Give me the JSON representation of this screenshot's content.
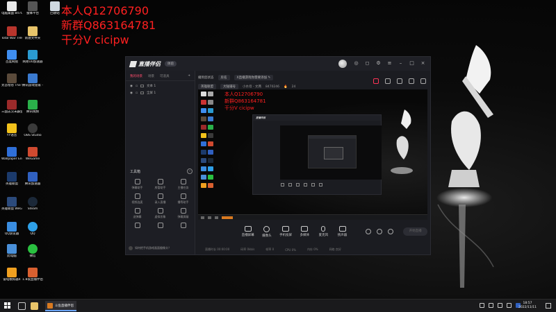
{
  "overlay": {
    "line1": "本人Q12706790",
    "line2": "新群Q863164781",
    "line3": "干分V cicipw"
  },
  "desktop_icons": [
    {
      "label": "电脑桌面\n8470246",
      "icon": "pc-folder-icon",
      "color": "#e8e8e8"
    },
    {
      "label": "Total War THREE KI...",
      "icon": "total-war-icon",
      "color": "#b8352c"
    },
    {
      "label": "百度网盘",
      "icon": "baidu-netdisk-icon",
      "color": "#3f8ef0"
    },
    {
      "label": "太吾绘卷 The Scr...",
      "icon": "taiwu-icon",
      "color": "#5a4a3a"
    },
    {
      "label": "三国志汉末霸业",
      "icon": "sanguo-icon",
      "color": "#9b2a2a"
    },
    {
      "label": "YY语音",
      "icon": "yy-icon",
      "color": "#f2c21b"
    },
    {
      "label": "Wallpaper Engine:...",
      "icon": "wallpaper-engine-icon",
      "color": "#2f6fd8"
    },
    {
      "label": "英雄联盟",
      "icon": "lol-icon",
      "color": "#1b3a6b"
    },
    {
      "label": "英雄联盟 WeGame版",
      "icon": "lol-wegame-icon",
      "color": "#2b4a7b"
    },
    {
      "label": "QQ游览器",
      "icon": "qq-browser-icon",
      "color": "#3a8de0"
    },
    {
      "label": "此电脑",
      "icon": "this-pc-icon",
      "color": "#4a90d9"
    },
    {
      "label": "雷电模拟器4",
      "icon": "ldplayer-icon",
      "color": "#f0a020"
    },
    {
      "label": "斗鱼直播伴侣",
      "icon": "douyu-icon",
      "color": "#f07a20"
    },
    {
      "label": "回收站",
      "icon": "recycle-bin-icon",
      "color": "#cfd8e0"
    },
    {
      "label": "新建文件夹",
      "icon": "folder-icon",
      "color": "#e8c46a"
    },
    {
      "label": "网易UU加速器",
      "icon": "uu-icon",
      "color": "#2a9ad0"
    },
    {
      "label": "腾讯游戏管家 -专业加速",
      "icon": "tencent-game-icon",
      "color": "#3a7ad0"
    },
    {
      "label": "腾讯视频",
      "icon": "tencent-video-icon",
      "color": "#2ab04a"
    },
    {
      "label": "OBS Studio",
      "icon": "obs-icon",
      "color": "#3a3a3a"
    },
    {
      "label": "WeGame",
      "icon": "wegame-icon",
      "color": "#d04a30"
    },
    {
      "label": "腾讯加速器",
      "icon": "tencent-accel-icon",
      "color": "#3060c0"
    },
    {
      "label": "Steam",
      "icon": "steam-icon",
      "color": "#1b2838"
    },
    {
      "label": "QQ",
      "icon": "qq-icon",
      "color": "#2ea0e8"
    },
    {
      "label": "微信",
      "icon": "wechat-icon",
      "color": "#2ac040"
    },
    {
      "label": "1.8夜直播伴侣",
      "icon": "live-assistant-icon",
      "color": "#d96030"
    },
    {
      "label": "蜜蜂平台",
      "icon": "bee-icon",
      "color": "#555"
    }
  ],
  "app": {
    "title": "直播伴侣",
    "version_badge": "体验",
    "sidebar_tabs": [
      "我的场景",
      "场景",
      "可道具"
    ],
    "sources": [
      {
        "label": "文本 1"
      },
      {
        "label": "全屏 1"
      }
    ],
    "toolbox_title": "工具箱",
    "tools": [
      "弹幕助手",
      "房管助手",
      "主播任务",
      "视频连麦",
      "录入直播",
      "播等助手",
      "送弹幕",
      "虚拟形象",
      "弹幕屏蔽",
      "",
      "",
      ""
    ],
    "mic_hint": "如何把手机游戏画面摄像头？",
    "info_row1": [
      "播到您状态",
      "房名",
      "X直播游戏你需要添加  ✎"
    ],
    "info_row2": [
      "英雄联盟",
      "大陆铺号",
      "小水母 - 文两",
      "8470246",
      "24"
    ],
    "preview_overlay": {
      "line1": "本人Q12706790",
      "line2": "新群Q863164781",
      "line3": "干分V cicipw"
    },
    "controls": [
      "直播屏幕",
      "摄像头",
      "手机投屏",
      "多媒体",
      "麦克风",
      "扬声器"
    ],
    "start_live": "开始直播",
    "status": [
      "直播时长 00:00:00",
      "码率 0kb/s",
      "帧率 0",
      "CPU 0%",
      "内存 0%",
      "网络 良好"
    ]
  },
  "taskbar": {
    "app_label": "斗鱼直播伴侣",
    "time": "18:57",
    "date": "2022/11/11"
  }
}
